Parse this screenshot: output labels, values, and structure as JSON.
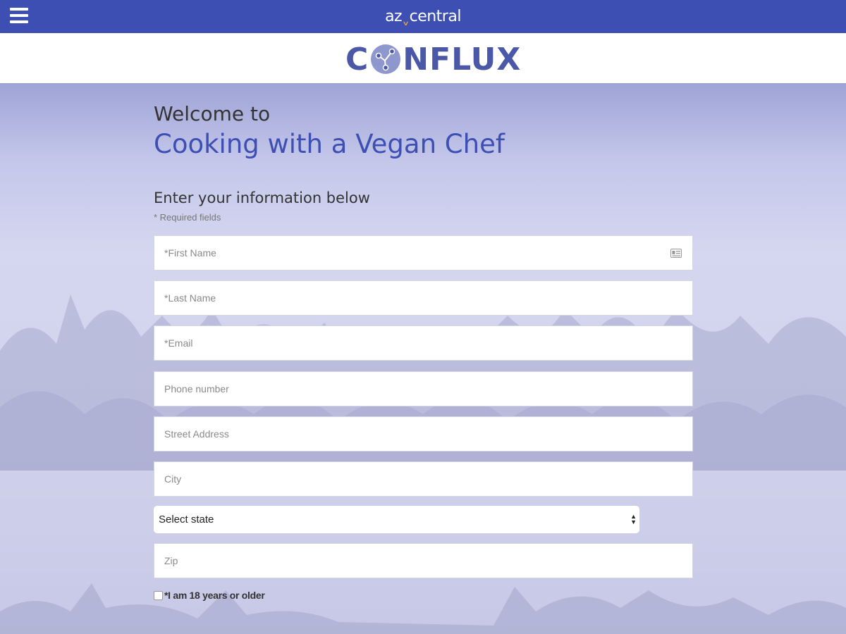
{
  "header": {
    "menu_icon": "hamburger-menu-icon",
    "brand_prefix": "az",
    "brand_suffix": "central",
    "brand_color": "#3d4fb3"
  },
  "logo": {
    "c_letter": "C",
    "suffix": "NFLUX",
    "color": "#4b58a8"
  },
  "intro": {
    "welcome": "Welcome to",
    "event_title": "Cooking with a Vegan Chef"
  },
  "form": {
    "heading": "Enter your information below",
    "required_note": "* Required fields",
    "fields": {
      "first_name": {
        "placeholder": "*First Name",
        "value": ""
      },
      "last_name": {
        "placeholder": "*Last Name",
        "value": ""
      },
      "email": {
        "placeholder": "*Email",
        "value": ""
      },
      "phone": {
        "placeholder": "Phone number",
        "value": ""
      },
      "street": {
        "placeholder": "Street Address",
        "value": ""
      },
      "city": {
        "placeholder": "City",
        "value": ""
      },
      "zip": {
        "placeholder": "Zip",
        "value": ""
      }
    },
    "state_select": {
      "selected": "Select state"
    },
    "age_checkbox": {
      "label": "*I am 18 years or older",
      "checked": false
    }
  }
}
